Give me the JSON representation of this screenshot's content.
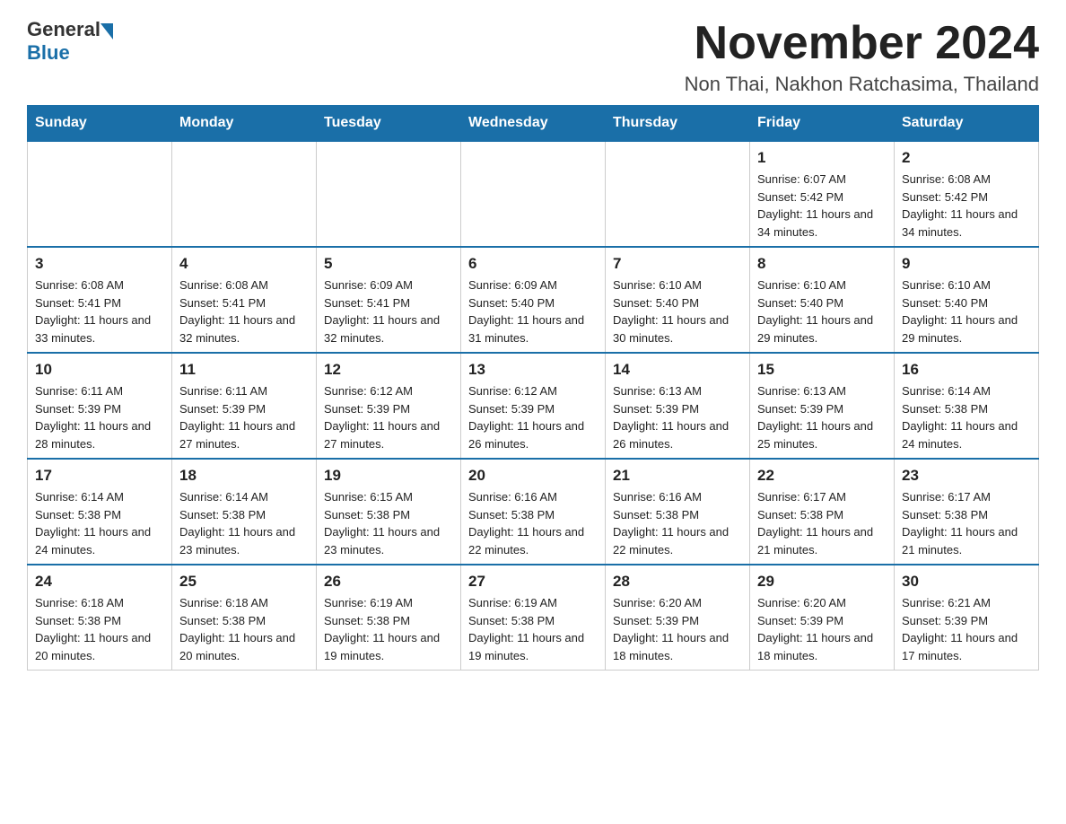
{
  "logo": {
    "general": "General",
    "blue": "Blue"
  },
  "header": {
    "month_year": "November 2024",
    "location": "Non Thai, Nakhon Ratchasima, Thailand"
  },
  "weekdays": [
    "Sunday",
    "Monday",
    "Tuesday",
    "Wednesday",
    "Thursday",
    "Friday",
    "Saturday"
  ],
  "weeks": [
    [
      {
        "day": "",
        "info": ""
      },
      {
        "day": "",
        "info": ""
      },
      {
        "day": "",
        "info": ""
      },
      {
        "day": "",
        "info": ""
      },
      {
        "day": "",
        "info": ""
      },
      {
        "day": "1",
        "info": "Sunrise: 6:07 AM\nSunset: 5:42 PM\nDaylight: 11 hours and 34 minutes."
      },
      {
        "day": "2",
        "info": "Sunrise: 6:08 AM\nSunset: 5:42 PM\nDaylight: 11 hours and 34 minutes."
      }
    ],
    [
      {
        "day": "3",
        "info": "Sunrise: 6:08 AM\nSunset: 5:41 PM\nDaylight: 11 hours and 33 minutes."
      },
      {
        "day": "4",
        "info": "Sunrise: 6:08 AM\nSunset: 5:41 PM\nDaylight: 11 hours and 32 minutes."
      },
      {
        "day": "5",
        "info": "Sunrise: 6:09 AM\nSunset: 5:41 PM\nDaylight: 11 hours and 32 minutes."
      },
      {
        "day": "6",
        "info": "Sunrise: 6:09 AM\nSunset: 5:40 PM\nDaylight: 11 hours and 31 minutes."
      },
      {
        "day": "7",
        "info": "Sunrise: 6:10 AM\nSunset: 5:40 PM\nDaylight: 11 hours and 30 minutes."
      },
      {
        "day": "8",
        "info": "Sunrise: 6:10 AM\nSunset: 5:40 PM\nDaylight: 11 hours and 29 minutes."
      },
      {
        "day": "9",
        "info": "Sunrise: 6:10 AM\nSunset: 5:40 PM\nDaylight: 11 hours and 29 minutes."
      }
    ],
    [
      {
        "day": "10",
        "info": "Sunrise: 6:11 AM\nSunset: 5:39 PM\nDaylight: 11 hours and 28 minutes."
      },
      {
        "day": "11",
        "info": "Sunrise: 6:11 AM\nSunset: 5:39 PM\nDaylight: 11 hours and 27 minutes."
      },
      {
        "day": "12",
        "info": "Sunrise: 6:12 AM\nSunset: 5:39 PM\nDaylight: 11 hours and 27 minutes."
      },
      {
        "day": "13",
        "info": "Sunrise: 6:12 AM\nSunset: 5:39 PM\nDaylight: 11 hours and 26 minutes."
      },
      {
        "day": "14",
        "info": "Sunrise: 6:13 AM\nSunset: 5:39 PM\nDaylight: 11 hours and 26 minutes."
      },
      {
        "day": "15",
        "info": "Sunrise: 6:13 AM\nSunset: 5:39 PM\nDaylight: 11 hours and 25 minutes."
      },
      {
        "day": "16",
        "info": "Sunrise: 6:14 AM\nSunset: 5:38 PM\nDaylight: 11 hours and 24 minutes."
      }
    ],
    [
      {
        "day": "17",
        "info": "Sunrise: 6:14 AM\nSunset: 5:38 PM\nDaylight: 11 hours and 24 minutes."
      },
      {
        "day": "18",
        "info": "Sunrise: 6:14 AM\nSunset: 5:38 PM\nDaylight: 11 hours and 23 minutes."
      },
      {
        "day": "19",
        "info": "Sunrise: 6:15 AM\nSunset: 5:38 PM\nDaylight: 11 hours and 23 minutes."
      },
      {
        "day": "20",
        "info": "Sunrise: 6:16 AM\nSunset: 5:38 PM\nDaylight: 11 hours and 22 minutes."
      },
      {
        "day": "21",
        "info": "Sunrise: 6:16 AM\nSunset: 5:38 PM\nDaylight: 11 hours and 22 minutes."
      },
      {
        "day": "22",
        "info": "Sunrise: 6:17 AM\nSunset: 5:38 PM\nDaylight: 11 hours and 21 minutes."
      },
      {
        "day": "23",
        "info": "Sunrise: 6:17 AM\nSunset: 5:38 PM\nDaylight: 11 hours and 21 minutes."
      }
    ],
    [
      {
        "day": "24",
        "info": "Sunrise: 6:18 AM\nSunset: 5:38 PM\nDaylight: 11 hours and 20 minutes."
      },
      {
        "day": "25",
        "info": "Sunrise: 6:18 AM\nSunset: 5:38 PM\nDaylight: 11 hours and 20 minutes."
      },
      {
        "day": "26",
        "info": "Sunrise: 6:19 AM\nSunset: 5:38 PM\nDaylight: 11 hours and 19 minutes."
      },
      {
        "day": "27",
        "info": "Sunrise: 6:19 AM\nSunset: 5:38 PM\nDaylight: 11 hours and 19 minutes."
      },
      {
        "day": "28",
        "info": "Sunrise: 6:20 AM\nSunset: 5:39 PM\nDaylight: 11 hours and 18 minutes."
      },
      {
        "day": "29",
        "info": "Sunrise: 6:20 AM\nSunset: 5:39 PM\nDaylight: 11 hours and 18 minutes."
      },
      {
        "day": "30",
        "info": "Sunrise: 6:21 AM\nSunset: 5:39 PM\nDaylight: 11 hours and 17 minutes."
      }
    ]
  ]
}
